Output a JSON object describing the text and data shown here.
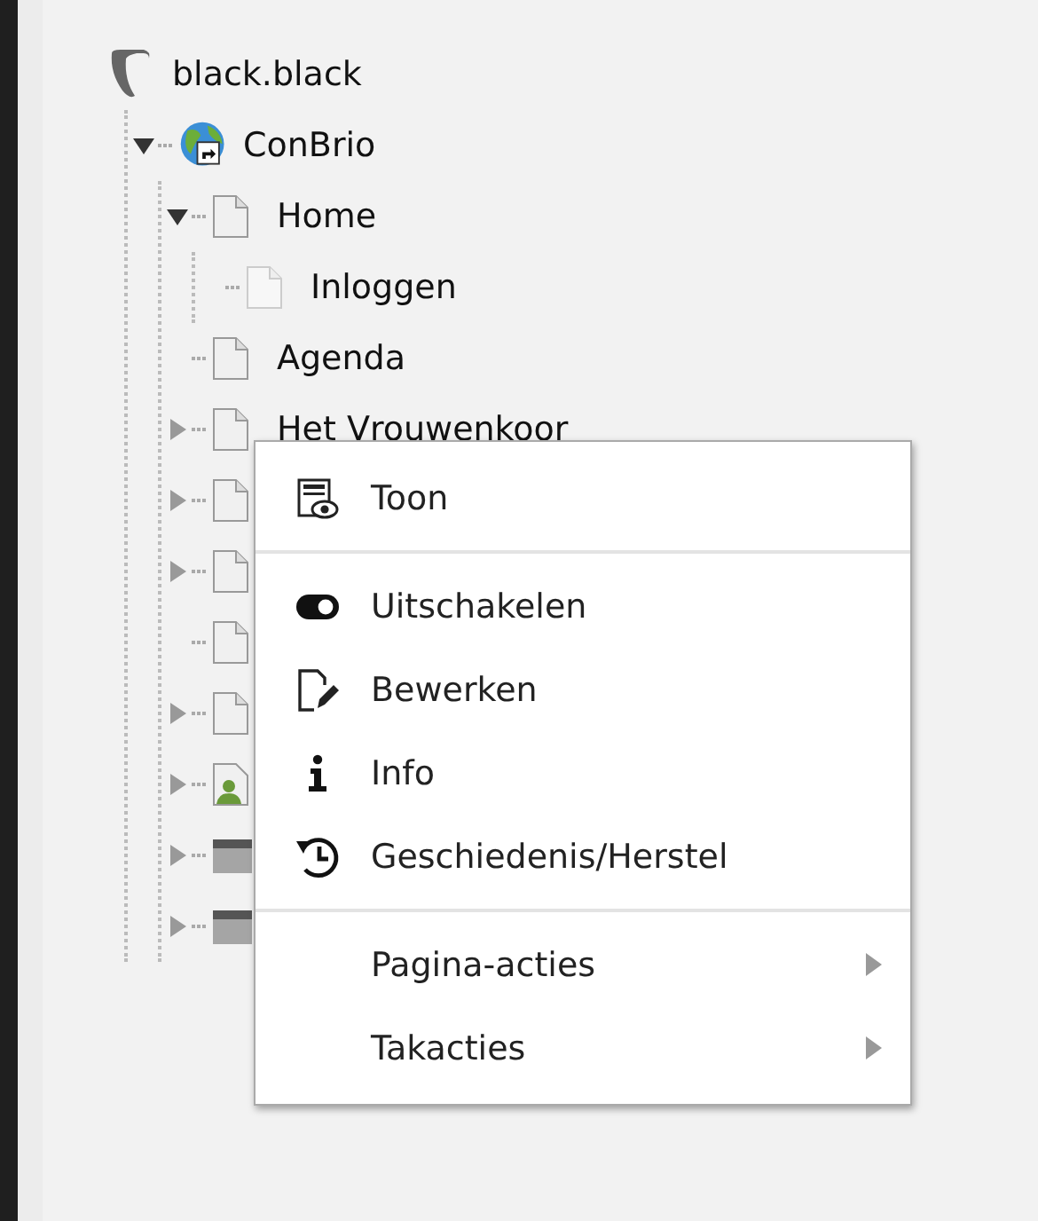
{
  "tree": {
    "root": {
      "label": "black.black",
      "kind": "logo"
    },
    "children": [
      {
        "label": "ConBrio",
        "kind": "site",
        "expanded": true,
        "children": [
          {
            "label": "Home",
            "kind": "page",
            "expanded": true,
            "children": [
              {
                "label": "Inloggen",
                "kind": "page-faded"
              }
            ]
          },
          {
            "label": "Agenda",
            "kind": "page"
          },
          {
            "label": "Het Vrouwenkoor",
            "kind": "page",
            "expanded": false
          },
          {
            "kind": "page",
            "expanded": false
          },
          {
            "kind": "page",
            "expanded": false
          },
          {
            "kind": "page"
          },
          {
            "kind": "page",
            "expanded": false
          },
          {
            "kind": "user-page",
            "expanded": false
          },
          {
            "kind": "folder",
            "expanded": false
          },
          {
            "kind": "folder",
            "expanded": false
          }
        ]
      }
    ]
  },
  "context_menu": {
    "items": [
      {
        "kind": "view",
        "label": "Toon"
      },
      {
        "kind": "divider"
      },
      {
        "kind": "toggle",
        "label": "Uitschakelen"
      },
      {
        "kind": "edit",
        "label": "Bewerken"
      },
      {
        "kind": "info",
        "label": "Info"
      },
      {
        "kind": "history",
        "label": "Geschiedenis/Herstel"
      },
      {
        "kind": "divider"
      },
      {
        "kind": "submenu",
        "label": "Pagina-acties"
      },
      {
        "kind": "submenu",
        "label": "Takacties"
      }
    ]
  }
}
